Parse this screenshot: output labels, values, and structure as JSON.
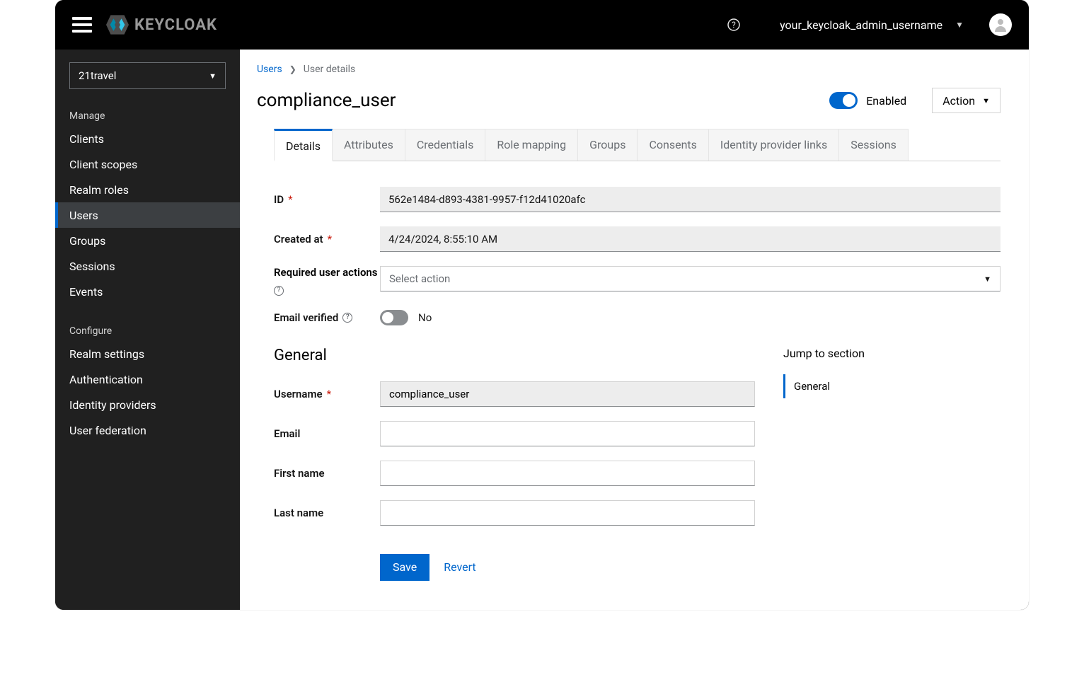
{
  "topbar": {
    "logo_text": "KEYCLOAK",
    "username": "your_keycloak_admin_username"
  },
  "sidebar": {
    "realm": "21travel",
    "section_manage": "Manage",
    "section_configure": "Configure",
    "manage_items": [
      "Clients",
      "Client scopes",
      "Realm roles",
      "Users",
      "Groups",
      "Sessions",
      "Events"
    ],
    "configure_items": [
      "Realm settings",
      "Authentication",
      "Identity providers",
      "User federation"
    ],
    "active": "Users"
  },
  "breadcrumb": {
    "link": "Users",
    "current": "User details"
  },
  "header": {
    "title": "compliance_user",
    "enabled_label": "Enabled",
    "action_label": "Action"
  },
  "tabs": [
    "Details",
    "Attributes",
    "Credentials",
    "Role mapping",
    "Groups",
    "Consents",
    "Identity provider links",
    "Sessions"
  ],
  "active_tab": "Details",
  "fields": {
    "id_label": "ID",
    "id_value": "562e1484-d893-4381-9957-f12d41020afc",
    "created_label": "Created at",
    "created_value": "4/24/2024, 8:55:10 AM",
    "rua_label": "Required user actions",
    "rua_placeholder": "Select action",
    "ev_label": "Email verified",
    "ev_value": "No",
    "general_heading": "General",
    "username_label": "Username",
    "username_value": "compliance_user",
    "email_label": "Email",
    "email_value": "",
    "fname_label": "First name",
    "fname_value": "",
    "lname_label": "Last name",
    "lname_value": ""
  },
  "jump": {
    "heading": "Jump to section",
    "item": "General"
  },
  "buttons": {
    "save": "Save",
    "revert": "Revert"
  }
}
